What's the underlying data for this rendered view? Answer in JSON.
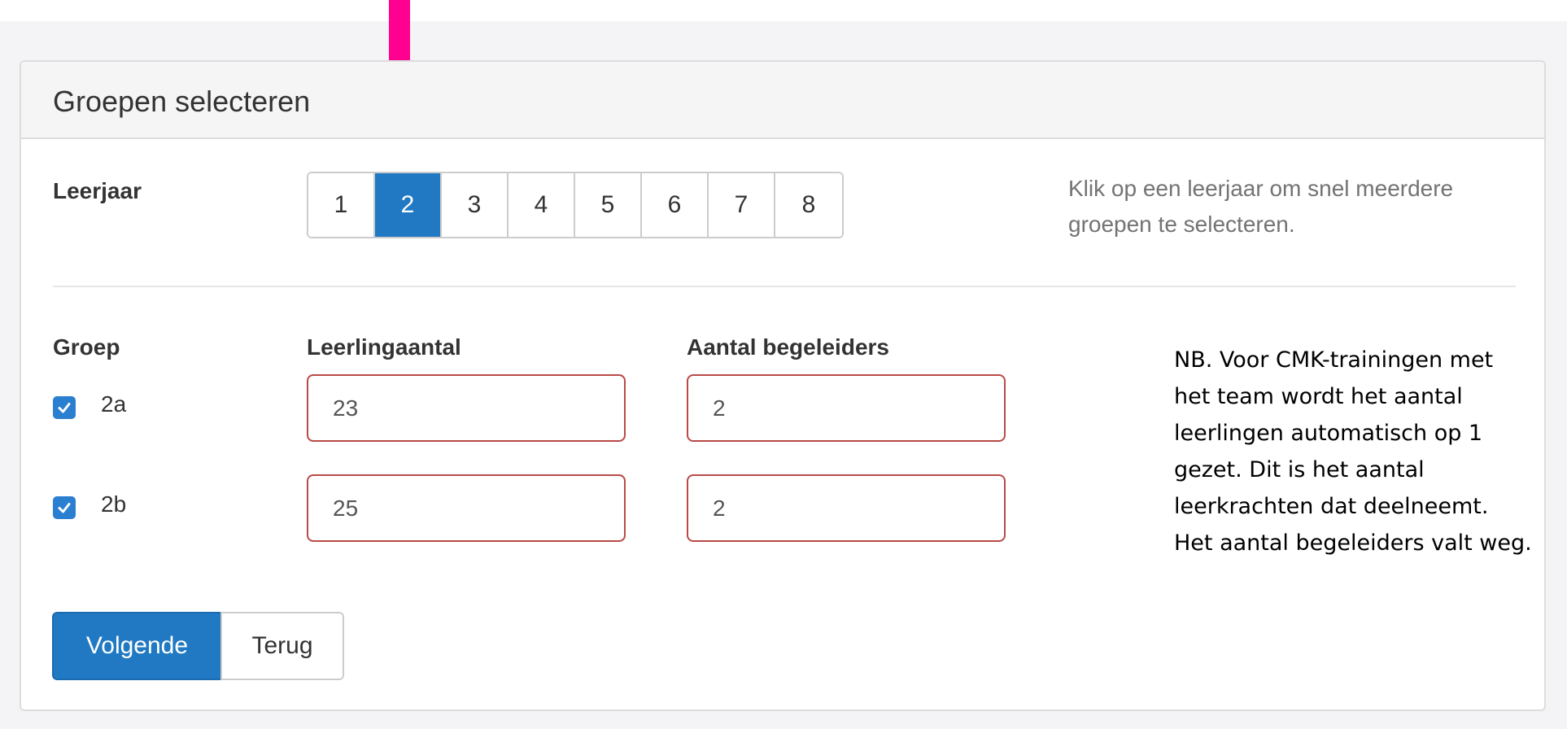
{
  "panel": {
    "title": "Groepen selecteren"
  },
  "leerjaar": {
    "label": "Leerjaar",
    "options": [
      "1",
      "2",
      "3",
      "4",
      "5",
      "6",
      "7",
      "8"
    ],
    "selected": "2",
    "help_text": "Klik op een leerjaar om snel meerdere groepen te selecteren."
  },
  "table": {
    "headers": {
      "groep": "Groep",
      "leerlingaantal": "Leerlingaantal",
      "begeleiders": "Aantal begeleiders"
    },
    "rows": [
      {
        "name": "2a",
        "checked": true,
        "leerlingaantal": "23",
        "begeleiders": "2"
      },
      {
        "name": "2b",
        "checked": true,
        "leerlingaantal": "25",
        "begeleiders": "2"
      }
    ]
  },
  "note": "NB. Voor CMK-trainingen met het team wordt het aantal leerlingen automatisch op 1 gezet. Dit is het aantal leerkrachten dat deelneemt.  Het aantal begeleiders valt weg.",
  "buttons": {
    "next": "Volgende",
    "back": "Terug"
  },
  "colors": {
    "primary": "#2079c2",
    "error_border": "#b94a48",
    "annotation_arrow": "#ff0090"
  },
  "icons": {
    "checkbox": "checkmark-icon",
    "arrow": "down-arrow-icon"
  }
}
